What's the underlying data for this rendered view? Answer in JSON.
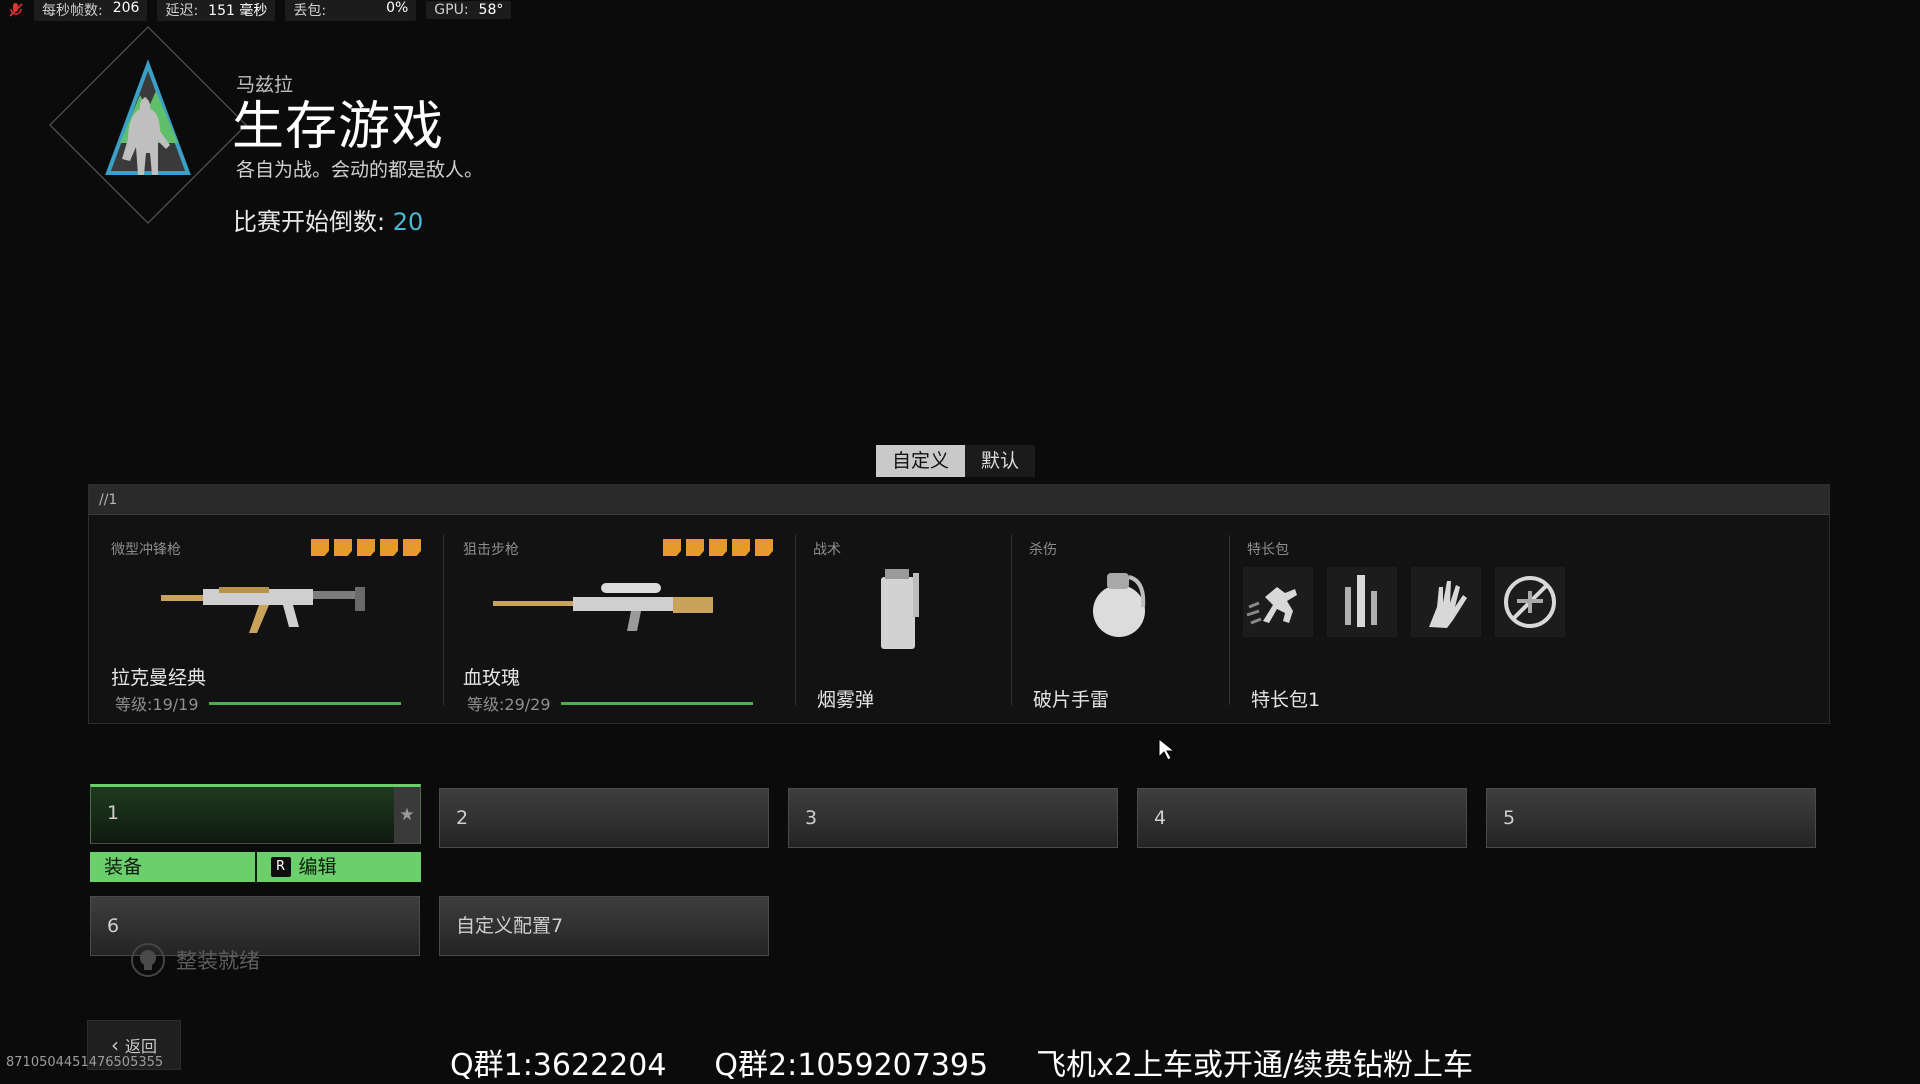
{
  "overlay": {
    "fps_label": "每秒帧数:",
    "fps_value": "206",
    "latency_label": "延迟:",
    "latency_value": "151 毫秒",
    "loss_label": "丢包:",
    "loss_value": "0%",
    "gpu_label": "GPU:",
    "gpu_value": "58°"
  },
  "mode": {
    "map": "马兹拉",
    "title": "生存游戏",
    "description": "各自为战。会动的都是敌人。",
    "countdown_label": "比赛开始倒数:",
    "countdown_value": "20",
    "emblem_icon": "soldier-silhouette-emblem"
  },
  "toggle": {
    "custom": "自定义",
    "default": "默认",
    "active": "custom"
  },
  "loadout": {
    "header": "//1",
    "primary": {
      "category": "微型冲锋枪",
      "name": "拉克曼经典",
      "level_text": "等级:19/19",
      "level_progress": 1.0,
      "tier": 5,
      "icon": "smg-icon"
    },
    "secondary": {
      "category": "狙击步枪",
      "name": "血玫瑰",
      "level_text": "等级:29/29",
      "level_progress": 1.0,
      "tier": 5,
      "icon": "sniper-rifle-icon"
    },
    "tactical": {
      "category": "战术",
      "name": "烟雾弹",
      "icon": "smoke-grenade-icon"
    },
    "lethal": {
      "category": "杀伤",
      "name": "破片手雷",
      "icon": "frag-grenade-icon"
    },
    "perks": {
      "category": "特长包",
      "name": "特长包1",
      "icons": [
        "sprint-perk-icon",
        "overkill-perk-icon",
        "hands-perk-icon",
        "no-uav-perk-icon"
      ]
    }
  },
  "loadouts": {
    "slots": [
      "1",
      "2",
      "3",
      "4",
      "5",
      "6",
      "自定义配置7"
    ],
    "selected": "1",
    "equip_label": "装备",
    "edit_key": "R",
    "edit_label": "编辑"
  },
  "footer": {
    "ready_label": "整装就绪",
    "back_label": "返回",
    "stream_id": "8710504451476505355",
    "promo_1": "Q群1:3622204",
    "promo_2": "Q群2:1059207395",
    "promo_3": "飞机x2上车或开通/续费钻粉上车"
  },
  "colors": {
    "accent_green": "#6bd06b",
    "tier_orange": "#e79a2c",
    "countdown_blue": "#4fb6d6"
  }
}
